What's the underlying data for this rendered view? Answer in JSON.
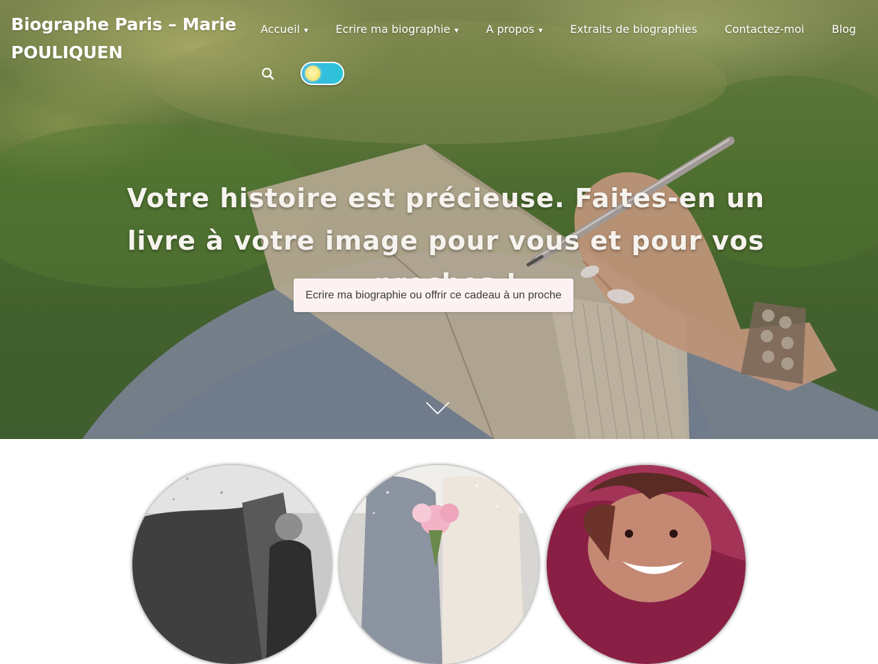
{
  "header": {
    "site_title": "Biographe Paris – Marie POULIQUEN"
  },
  "nav": {
    "items": [
      {
        "label": "Accueil",
        "has_dropdown": true
      },
      {
        "label": "Ecrire ma biographie",
        "has_dropdown": true
      },
      {
        "label": "A propos",
        "has_dropdown": true
      },
      {
        "label": "Extraits de biographies",
        "has_dropdown": false
      },
      {
        "label": "Contactez-moi",
        "has_dropdown": false
      },
      {
        "label": "Blog",
        "has_dropdown": false
      }
    ],
    "dropdown_marker": "▼",
    "search_icon": "search-icon",
    "theme_toggle": {
      "state": "light",
      "track_color": "#3fb6e6",
      "knob_color": "#f0de5c"
    }
  },
  "hero": {
    "headline": "Votre histoire est précieuse. Faites-en un livre à votre image pour vous et pour vos proches !",
    "cta_label": "Ecrire ma biographie ou offrir ce cadeau à un proche",
    "scroll_icon": "chevron-down-icon"
  },
  "feature_images": [
    {
      "icon": "vintage-photo-image"
    },
    {
      "icon": "wedding-photo-image"
    },
    {
      "icon": "smiling-woman-photo-image"
    }
  ],
  "colors": {
    "cta_background": "#fdf2f2",
    "nav_text": "#ffffff",
    "headline_text": "#f6f3ee"
  }
}
